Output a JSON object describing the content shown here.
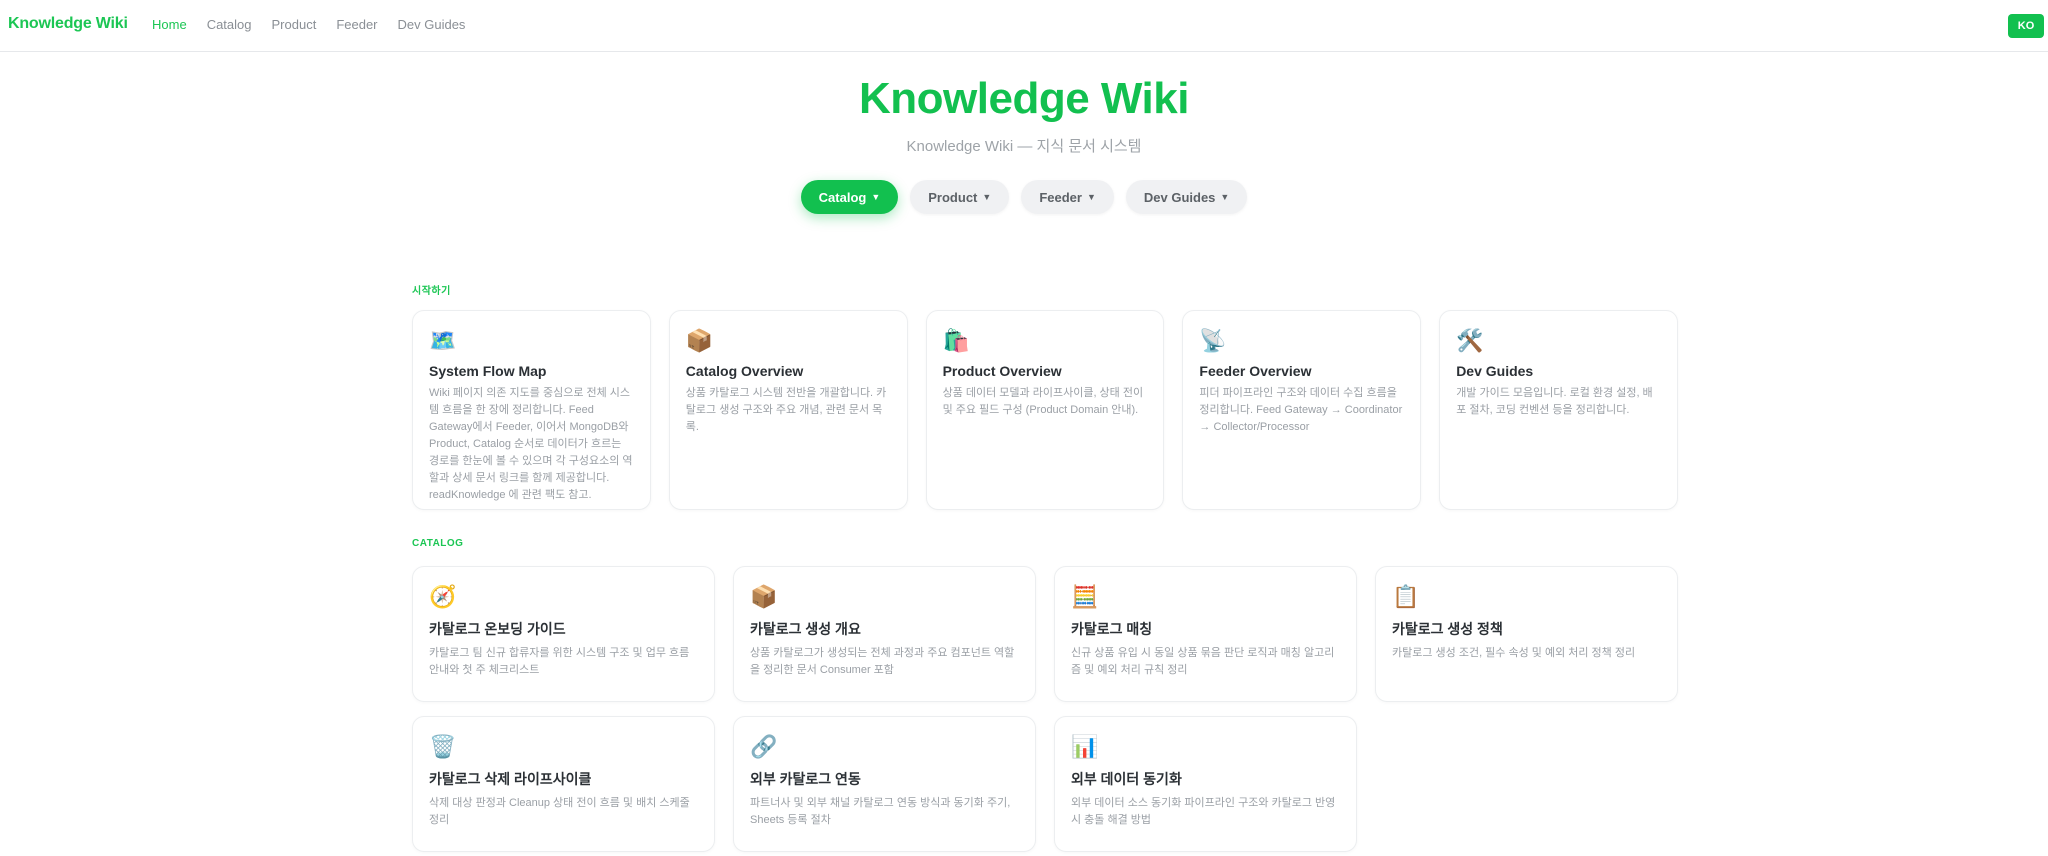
{
  "header": {
    "brand": "Knowledge Wiki",
    "nav": [
      {
        "label": "Home",
        "active": true
      },
      {
        "label": "Catalog",
        "active": false
      },
      {
        "label": "Product",
        "active": false
      },
      {
        "label": "Feeder",
        "active": false
      },
      {
        "label": "Dev Guides",
        "active": false
      }
    ],
    "lang_label": "KO"
  },
  "hero": {
    "title": "Knowledge Wiki",
    "subtitle": "Knowledge Wiki — 지식 문서 시스템"
  },
  "pills": [
    {
      "label": "Catalog",
      "active": true
    },
    {
      "label": "Product",
      "active": false
    },
    {
      "label": "Feeder",
      "active": false
    },
    {
      "label": "Dev Guides",
      "active": false
    }
  ],
  "sections": {
    "overview": {
      "label": "시작하기",
      "cards": [
        {
          "icon": "🗺️",
          "title": "System Flow Map",
          "desc": "Wiki 페이지 의존 지도를 중심으로 전체 시스템 흐름을 한 장에 정리합니다. Feed Gateway에서 Feeder, 이어서 MongoDB와 Product, Catalog 순서로 데이터가 흐르는 경로를 한눈에 볼 수 있으며 각 구성요소의 역할과 상세 문서 링크를 함께 제공합니다. readKnowledge 에 관련 팩도 참고."
        },
        {
          "icon": "📦",
          "title": "Catalog Overview",
          "desc": "상품 카탈로그 시스템 전반을 개괄합니다. 카탈로그 생성 구조와 주요 개념, 관련 문서 목록."
        },
        {
          "icon": "🛍️",
          "title": "Product Overview",
          "desc": "상품 데이터 모델과 라이프사이클, 상태 전이 및 주요 필드 구성 (Product Domain 안내)."
        },
        {
          "icon": "📡",
          "title": "Feeder Overview",
          "desc": "피더 파이프라인 구조와 데이터 수집 흐름을 정리합니다. Feed Gateway → Coordinator → Collector/Processor"
        },
        {
          "icon": "🛠️",
          "title": "Dev Guides",
          "desc": "개발 가이드 모음입니다. 로컬 환경 설정, 배포 절차, 코딩 컨벤션 등을 정리합니다."
        }
      ]
    },
    "catalog": {
      "label": "CATALOG",
      "cards": [
        {
          "icon": "🧭",
          "title": "카탈로그 온보딩 가이드",
          "desc": "카탈로그 팀 신규 합류자를 위한 시스템 구조 및 업무 흐름 안내와 첫 주 체크리스트"
        },
        {
          "icon": "📦",
          "title": "카탈로그 생성 개요",
          "desc": "상품 카탈로그가 생성되는 전체 과정과 주요 컴포넌트 역할을 정리한 문서 Consumer 포함"
        },
        {
          "icon": "🧮",
          "title": "카탈로그 매칭",
          "desc": "신규 상품 유입 시 동일 상품 묶음 판단 로직과 매칭 알고리즘 및 예외 처리 규칙 정리"
        },
        {
          "icon": "📋",
          "title": "카탈로그 생성 정책",
          "desc": "카탈로그 생성 조건, 필수 속성 및 예외 처리 정책 정리"
        },
        {
          "icon": "🗑️",
          "title": "카탈로그 삭제 라이프사이클",
          "desc": "삭제 대상 판정과 Cleanup 상태 전이 흐름 및 배치 스케줄 정리"
        },
        {
          "icon": "🔗",
          "title": "외부 카탈로그 연동",
          "desc": "파트너사 및 외부 채널 카탈로그 연동 방식과 동기화 주기, Sheets 등록 절차"
        },
        {
          "icon": "📊",
          "title": "외부 데이터 동기화",
          "desc": "외부 데이터 소스 동기화 파이프라인 구조와 카탈로그 반영 시 충돌 해결 방법"
        }
      ]
    }
  },
  "colors": {
    "accent": "#12c04f",
    "brand_text": "#1cc654",
    "muted": "#9a9fa5"
  }
}
